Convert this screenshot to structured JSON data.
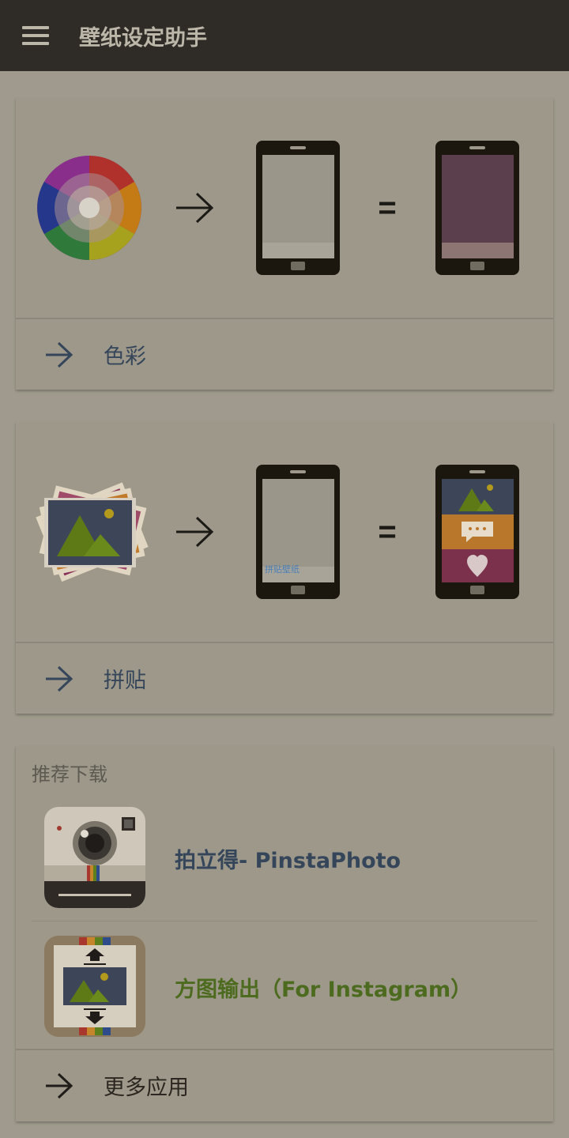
{
  "app_bar": {
    "title": "壁纸设定助手",
    "menu_icon": "hamburger-menu-icon"
  },
  "cards": [
    {
      "illustration": [
        "color-wheel-icon",
        "right-arrow-icon",
        "phone-icon",
        "equals-sign",
        "phone-colored-icon"
      ],
      "equals_text": "=",
      "action_label": "色彩",
      "action_icon": "arrow-right-icon"
    },
    {
      "illustration": [
        "photo-stack-icon",
        "right-arrow-icon",
        "phone-icon",
        "equals-sign",
        "phone-collage-icon"
      ],
      "equals_text": "=",
      "phone_caption": "拼贴壁纸",
      "action_label": "拼贴",
      "action_icon": "arrow-right-icon"
    }
  ],
  "recommend": {
    "title": "推荐下载",
    "apps": [
      {
        "name": "拍立得- PinstaPhoto",
        "icon": "instant-camera-app-icon",
        "color": "#35465a"
      },
      {
        "name": "方图输出（For Instagram）",
        "icon": "square-photo-app-icon",
        "color": "#4c6b1f"
      }
    ],
    "more_label": "更多应用",
    "more_icon": "arrow-right-icon"
  },
  "colors": {
    "app_bar": "#2f2c27",
    "background": "#9f9a8d",
    "card": "#9d9889",
    "action_text": "#35465a"
  }
}
